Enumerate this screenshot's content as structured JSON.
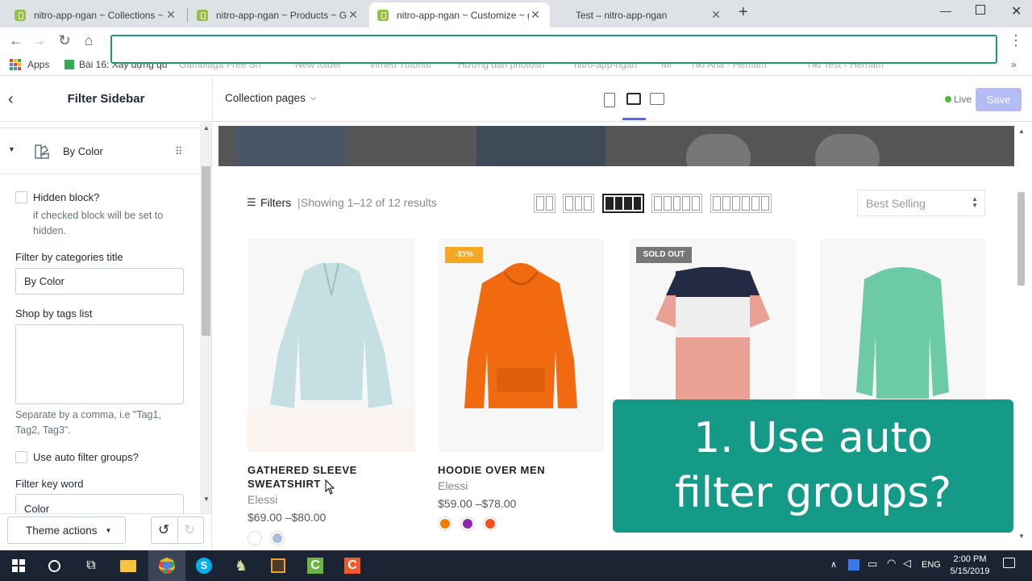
{
  "browser": {
    "tabs": [
      {
        "title": "nitro-app-ngan ~ Collections ~ T",
        "active": false
      },
      {
        "title": "nitro-app-ngan ~ Products ~ Ga",
        "active": false
      },
      {
        "title": "nitro-app-ngan ~ Customize ~ g",
        "active": true
      },
      {
        "title": "Test – nitro-app-ngan",
        "active": false
      }
    ],
    "new_tab": "+",
    "bookmarks": [
      "Apps",
      "Bài 16: Xây dựng qu",
      "Gambiaga Free Sh",
      "New folder",
      "Vimeo Tutorial",
      "Hướng dẫn photosh",
      "nitro-app-ngan",
      "Mi",
      "Tiki Aria - Hemam",
      "Tiki Test - Hemam"
    ]
  },
  "header": {
    "title": "Filter Sidebar",
    "page_select": "Collection pages",
    "status": "Live",
    "save": "Save"
  },
  "sidebar": {
    "block_title": "By Color",
    "hidden_label": "Hidden block?",
    "hidden_hint": "if checked block will be set to hidden.",
    "categories_title_label": "Filter by categories title",
    "categories_title_value": "By Color",
    "tags_label": "Shop by tags list",
    "tags_hint": "Separate by a comma, i.e \"Tag1, Tag2, Tag3\".",
    "auto_label": "Use auto filter groups?",
    "keyword_label": "Filter key word",
    "keyword_value": "Color",
    "theme_actions": "Theme actions"
  },
  "preview": {
    "filters_label": "Filters",
    "results": "Showing 1–12 of 12 results",
    "sort": "Best Selling",
    "products": [
      {
        "name": "GATHERED SLEEVE SWEATSHIRT",
        "vendor": "Elessi",
        "price": "$69.00 –$80.00",
        "badge": "",
        "swatches": [
          "#ffffff",
          "#aabbdd"
        ],
        "color": "#c5dfe2"
      },
      {
        "name": "HOODIE OVER MEN",
        "vendor": "Elessi",
        "price": "$59.00 –$78.00",
        "badge": "-31%",
        "swatches": [
          "#f57c00",
          "#8e24aa",
          "#f4511e"
        ],
        "color": "#f26a0f"
      },
      {
        "name": "",
        "vendor": "",
        "price": "",
        "badge": "SOLD OUT",
        "swatches": [],
        "color": "#e9a193"
      },
      {
        "name": "",
        "vendor": "",
        "price": "",
        "badge": "",
        "swatches": [],
        "color": "#6ccba4"
      }
    ]
  },
  "overlay": {
    "line1": "1. Use auto",
    "line2": "filter groups?"
  },
  "taskbar": {
    "time": "2:00 PM",
    "date": "5/15/2019",
    "lang": "ENG"
  }
}
